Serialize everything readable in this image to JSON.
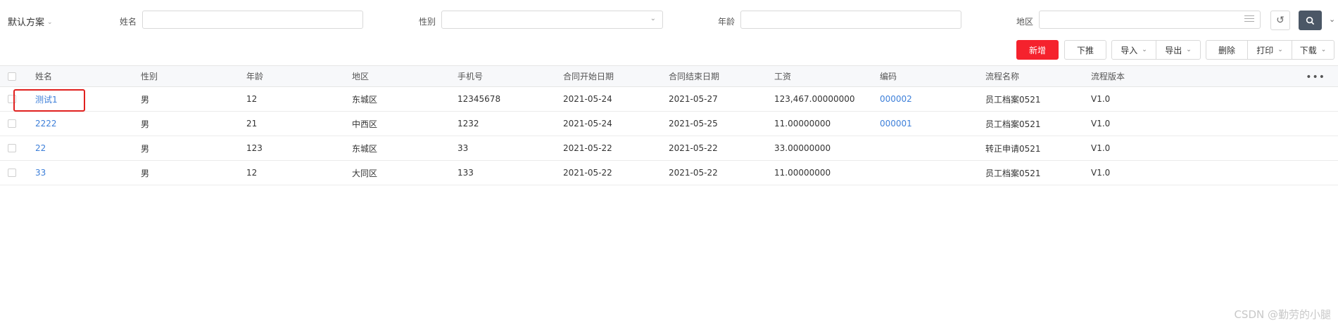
{
  "filter": {
    "scheme_label": "默认方案",
    "fields": [
      {
        "label": "姓名",
        "value": ""
      },
      {
        "label": "性别",
        "value": ""
      },
      {
        "label": "年龄",
        "value": ""
      },
      {
        "label": "地区",
        "value": ""
      }
    ]
  },
  "toolbar": {
    "add": "新增",
    "push": "下推",
    "import": "导入",
    "export": "导出",
    "delete": "删除",
    "print": "打印",
    "download": "下载"
  },
  "table": {
    "columns": [
      "姓名",
      "性别",
      "年龄",
      "地区",
      "手机号",
      "合同开始日期",
      "合同结束日期",
      "工资",
      "编码",
      "流程名称",
      "流程版本"
    ],
    "rows": [
      {
        "name": "测试1",
        "gender": "男",
        "age": "12",
        "region": "东城区",
        "phone": "12345678",
        "start": "2021-05-24",
        "end": "2021-05-27",
        "salary": "123,467.00000000",
        "code": "000002",
        "process": "员工档案0521",
        "version": "V1.0"
      },
      {
        "name": "2222",
        "gender": "男",
        "age": "21",
        "region": "中西区",
        "phone": "1232",
        "start": "2021-05-24",
        "end": "2021-05-25",
        "salary": "11.00000000",
        "code": "000001",
        "process": "员工档案0521",
        "version": "V1.0"
      },
      {
        "name": "22",
        "gender": "男",
        "age": "123",
        "region": "东城区",
        "phone": "33",
        "start": "2021-05-22",
        "end": "2021-05-22",
        "salary": "33.00000000",
        "code": "",
        "process": "转正申请0521",
        "version": "V1.0"
      },
      {
        "name": "33",
        "gender": "男",
        "age": "12",
        "region": "大同区",
        "phone": "133",
        "start": "2021-05-22",
        "end": "2021-05-22",
        "salary": "11.00000000",
        "code": "",
        "process": "员工档案0521",
        "version": "V1.0"
      }
    ]
  },
  "watermark": "CSDN @勤劳的小腿"
}
